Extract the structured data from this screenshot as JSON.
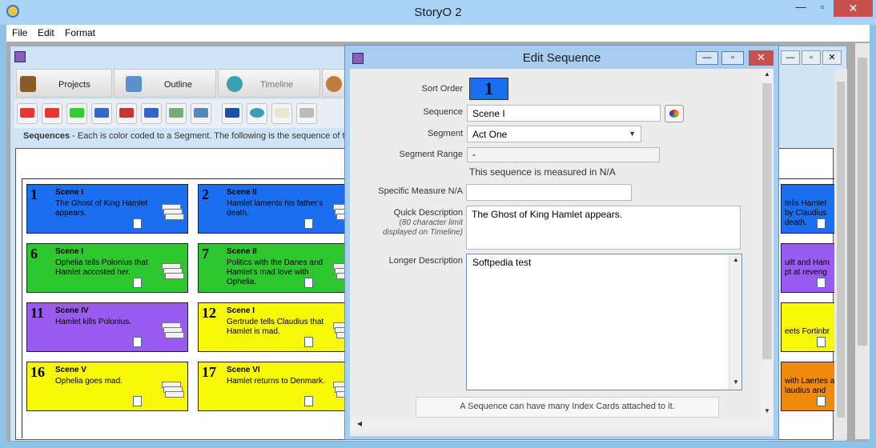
{
  "app": {
    "title": "StoryO 2"
  },
  "menu": [
    "File",
    "Edit",
    "Format"
  ],
  "window_controls": {
    "minimize": "—",
    "maximize": "▫",
    "close": "✕"
  },
  "tabs": [
    {
      "label": "Projects",
      "icon": "briefcase-icon",
      "color": "#8a5a2b"
    },
    {
      "label": "Outline",
      "icon": "outline-icon",
      "color": "#5b8fd0"
    },
    {
      "label": "Timeline",
      "icon": "timeline-icon",
      "color": "#3aa0b0"
    }
  ],
  "hint": {
    "bold": "Sequences",
    "text": " - Each is color coded to a Segment. The following is the sequence of th"
  },
  "cards": [
    {
      "num": "1",
      "title": "Scene I",
      "text": "The Ghost of King Hamlet appears.",
      "color": "#1a6ff0"
    },
    {
      "num": "2",
      "title": "Scene II",
      "text": "Hamlet laments his father's death.",
      "color": "#1a6ff0"
    },
    {
      "num": "6",
      "title": "Scene I",
      "text": "Ophelia tells Polonius that Hamlet accosted her.",
      "color": "#2fc72f"
    },
    {
      "num": "7",
      "title": "Scene II",
      "text": "Politics with the Danes and Hamlet's mad love with Ophelia.",
      "color": "#2fc72f"
    },
    {
      "num": "11",
      "title": "Scene IV",
      "text": "Hamlet kills Polonius.",
      "color": "#9a5cf0"
    },
    {
      "num": "12",
      "title": "Scene I",
      "text": "Gertrude tells Claudius that Hamlet is mad.",
      "color": "#f7f707"
    },
    {
      "num": "16",
      "title": "Scene V",
      "text": "Ophelia goes mad.",
      "color": "#f7f707"
    },
    {
      "num": "17",
      "title": "Scene VI",
      "text": "Hamlet returns to Denmark.",
      "color": "#f7f707"
    }
  ],
  "right_cards": [
    {
      "lines": [
        "tells Hamlet",
        "by Claudius",
        " death."
      ],
      "color": "#1a6ff0"
    },
    {
      "lines": [
        "uilt and Ham",
        "pt at reveng"
      ],
      "color": "#9a5cf0"
    },
    {
      "lines": [
        "",
        "eets Fortinbr"
      ],
      "color": "#f7f707"
    },
    {
      "lines": [
        "with Laertes a",
        "laudius and"
      ],
      "color": "#f08a0a"
    }
  ],
  "dialog": {
    "title": "Edit Sequence",
    "sort_order_label": "Sort Order",
    "sort_order": "1",
    "sequence_label": "Sequence",
    "sequence": "Scene I",
    "segment_label": "Segment",
    "segment": "Act One",
    "segment_range_label": "Segment Range",
    "segment_range": "-",
    "measure_note": "This sequence is measured in N/A",
    "specific_measure_label": "Specific Measure N/A",
    "specific_measure": "",
    "quick_desc_label": "Quick Description",
    "quick_desc_hint": "(80 character limit displayed on Timeline)",
    "quick_desc": "The Ghost of King Hamlet appears.",
    "longer_desc_label": "Longer Description",
    "longer_desc": "Softpedia test",
    "cards_note": "A Sequence can have many Index Cards attached to it."
  }
}
